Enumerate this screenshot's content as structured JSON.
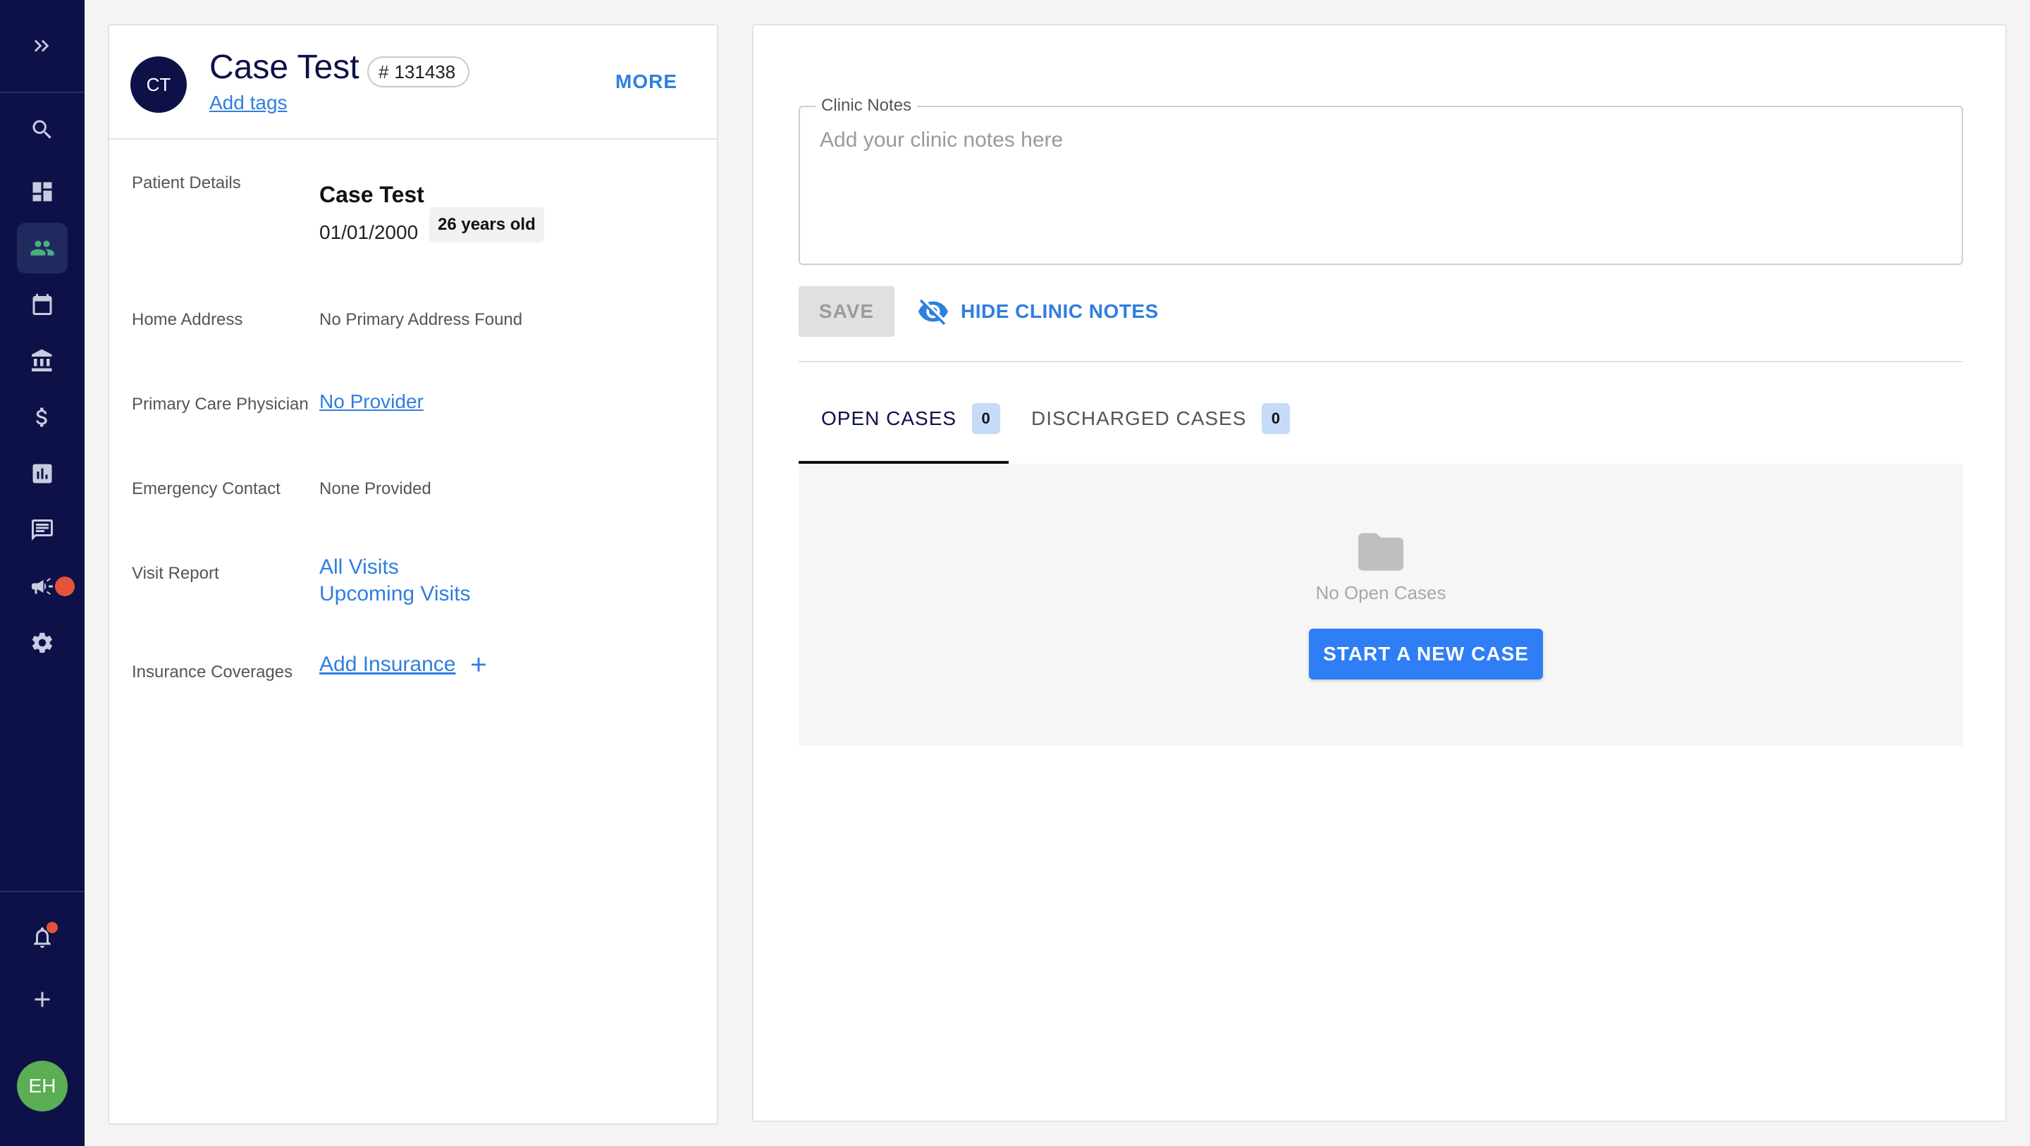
{
  "nav": {
    "items": [
      "chevrons-right-icon",
      "search-icon",
      "dashboard-icon",
      "patients-icon",
      "calendar-icon",
      "institution-icon",
      "dollar-icon",
      "reports-icon",
      "messages-icon",
      "megaphone-icon",
      "settings-icon",
      "bell-icon",
      "plus-icon"
    ],
    "active": "patients-icon",
    "user_initials": "EH"
  },
  "patient": {
    "initials": "CT",
    "name": "Case Test",
    "id": "131438",
    "add_tags_label": "Add tags",
    "more_label": "MORE",
    "details_label": "Patient Details",
    "details_name": "Case Test",
    "dob": "01/01/2000",
    "age": "26 years old",
    "home_address_label": "Home Address",
    "home_address_value": "No Primary Address Found",
    "pcp_label": "Primary Care Physician",
    "pcp_value": "No Provider",
    "emergency_label": "Emergency Contact",
    "emergency_value": "None Provided",
    "visit_report_label": "Visit Report",
    "visit_all": "All Visits",
    "visit_upcoming": "Upcoming Visits",
    "insurance_label": "Insurance Coverages",
    "insurance_value": "Add Insurance"
  },
  "notes": {
    "legend": "Clinic Notes",
    "placeholder": "Add your clinic notes here",
    "save_label": "SAVE",
    "hide_label": "HIDE CLINIC NOTES"
  },
  "tabs": {
    "open_label": "OPEN CASES",
    "open_count": "0",
    "discharged_label": "DISCHARGED CASES",
    "discharged_count": "0"
  },
  "cases": {
    "empty_text": "No Open Cases",
    "start_label": "START A NEW CASE"
  },
  "colors": {
    "nav_bg": "#0d1148",
    "accent": "#2f7ee0",
    "active_icon": "#4caf80",
    "alert": "#e5533d",
    "user_avatar": "#5cae55"
  }
}
